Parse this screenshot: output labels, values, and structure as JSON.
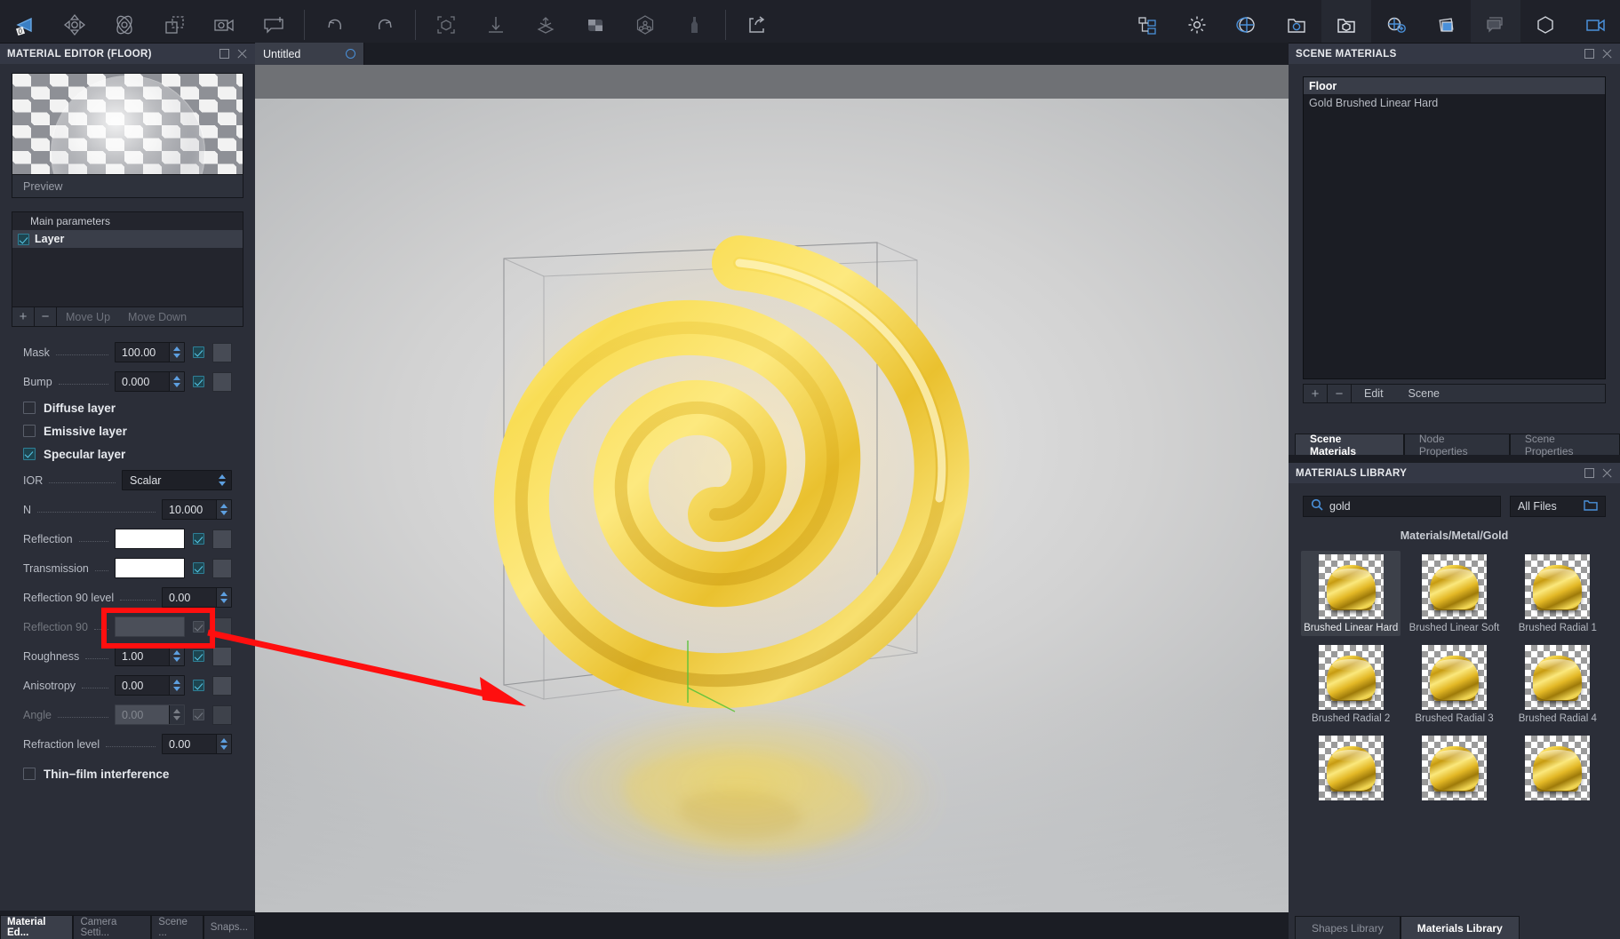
{
  "app": {
    "toolbar_left": [
      {
        "name": "select-tool",
        "icon": "cursor-arrow-icon"
      },
      {
        "name": "move-tool",
        "icon": "move-arrows-icon"
      },
      {
        "name": "rotate-tool",
        "icon": "orbit-rotate-icon"
      },
      {
        "name": "duplicate-tool",
        "icon": "copy-selection-icon"
      },
      {
        "name": "camera-settings-tool",
        "icon": "camera-gear-icon"
      },
      {
        "name": "add-annotation-tool",
        "icon": "note-plus-icon"
      },
      {
        "name": "undo",
        "icon": "undo-arrow-icon"
      },
      {
        "name": "redo",
        "icon": "redo-arrow-icon"
      },
      {
        "name": "fit-to-view",
        "icon": "cube-frame-icon"
      },
      {
        "name": "drop-to-floor",
        "icon": "down-arrow-to-line-icon"
      },
      {
        "name": "align-object",
        "icon": "axis-plane-icon"
      },
      {
        "name": "checker-pattern",
        "icon": "checker-square-icon"
      },
      {
        "name": "pivot-node",
        "icon": "hex-node-icon"
      },
      {
        "name": "measure-tool",
        "icon": "bottle-shape-icon"
      },
      {
        "name": "share-export",
        "icon": "share-arrow-icon"
      }
    ],
    "toolbar_right": [
      {
        "name": "scene-tree-panel",
        "icon": "tree-hierarchy-icon"
      },
      {
        "name": "preferences",
        "icon": "gear-icon"
      },
      {
        "name": "environment-panel",
        "icon": "globe-sphere-icon"
      },
      {
        "name": "environment-library",
        "icon": "folder-sphere-icon"
      },
      {
        "name": "shapes-library",
        "icon": "folder-cube-icon"
      },
      {
        "name": "add-environment",
        "icon": "sphere-plus-icon"
      },
      {
        "name": "images-panel",
        "icon": "photos-stack-icon"
      },
      {
        "name": "annotations-panel",
        "icon": "chat-bubbles-icon"
      },
      {
        "name": "geometry-panel",
        "icon": "cube-outline-icon"
      },
      {
        "name": "render-video-panel",
        "icon": "video-camera-icon"
      }
    ]
  },
  "material_editor": {
    "title": "MATERIAL EDITOR (FLOOR)",
    "preview_label": "Preview",
    "layers": {
      "header": "Main parameters",
      "items": [
        {
          "label": "Layer",
          "enabled": true
        }
      ],
      "footer": {
        "add": "+",
        "remove": "−",
        "move_up": "Move Up",
        "move_down": "Move Down"
      }
    },
    "params": [
      {
        "label": "Mask",
        "type": "spin",
        "value": "100.00",
        "check": true,
        "checked": true,
        "texture": true,
        "disabled": false
      },
      {
        "label": "Bump",
        "type": "spin",
        "value": "0.000",
        "check": true,
        "checked": true,
        "texture": true,
        "disabled": false
      }
    ],
    "layer_toggles": [
      {
        "label": "Diffuse layer",
        "checked": false
      },
      {
        "label": "Emissive layer",
        "checked": false
      },
      {
        "label": "Specular layer",
        "checked": true
      }
    ],
    "specular_params": [
      {
        "label": "IOR",
        "type": "combo",
        "value": "Scalar",
        "disabled": false
      },
      {
        "label": "N",
        "type": "spin",
        "value": "10.000",
        "check": false,
        "texture": false,
        "disabled": false
      },
      {
        "label": "Reflection",
        "type": "color",
        "value": "#ffffff",
        "check": true,
        "checked": true,
        "texture": true,
        "disabled": false
      },
      {
        "label": "Transmission",
        "type": "color",
        "value": "#ffffff",
        "check": true,
        "checked": true,
        "texture": true,
        "disabled": false
      },
      {
        "label": "Reflection 90 level",
        "type": "spin",
        "value": "0.00",
        "check": false,
        "texture": false,
        "disabled": false
      },
      {
        "label": "Reflection 90",
        "type": "spin",
        "value": "",
        "check": true,
        "checked": true,
        "texture": true,
        "disabled": true
      },
      {
        "label": "Roughness",
        "type": "spin",
        "value": "1.00",
        "check": true,
        "checked": true,
        "texture": true,
        "disabled": false,
        "highlighted": true
      },
      {
        "label": "Anisotropy",
        "type": "spin",
        "value": "0.00",
        "check": true,
        "checked": true,
        "texture": true,
        "disabled": false
      },
      {
        "label": "Angle",
        "type": "spin",
        "value": "0.00",
        "check": true,
        "checked": true,
        "texture": true,
        "disabled": true
      },
      {
        "label": "Refraction level",
        "type": "spin",
        "value": "0.00",
        "check": false,
        "texture": false,
        "disabled": false
      }
    ],
    "thin_film": {
      "label": "Thin−film interference",
      "checked": false
    },
    "bottom_tabs": [
      {
        "label": "Material Ed...",
        "selected": true
      },
      {
        "label": "Camera Setti...",
        "selected": false
      },
      {
        "label": "Scene ...",
        "selected": false
      },
      {
        "label": "Snaps...",
        "selected": false
      }
    ]
  },
  "viewport": {
    "tab_label": "Untitled",
    "tab_icon": "progress-circle-icon"
  },
  "scene_materials": {
    "title": "SCENE MATERIALS",
    "items": [
      {
        "label": "Floor",
        "selected": true
      },
      {
        "label": "Gold Brushed Linear Hard",
        "selected": false
      }
    ],
    "footer": {
      "add": "+",
      "remove": "−",
      "edit": "Edit",
      "scene": "Scene"
    },
    "tabs": [
      {
        "label": "Scene Materials",
        "selected": true
      },
      {
        "label": "Node Properties",
        "selected": false
      },
      {
        "label": "Scene Properties",
        "selected": false
      }
    ]
  },
  "materials_library": {
    "title": "MATERIALS LIBRARY",
    "search": {
      "value": "gold",
      "placeholder": "Search",
      "icon": "search-icon"
    },
    "filter": {
      "label": "All Files",
      "icon": "folder-icon"
    },
    "path": "Materials/Metal/Gold",
    "items": [
      {
        "label": "Brushed Linear Hard",
        "selected": true
      },
      {
        "label": "Brushed Linear Soft",
        "selected": false
      },
      {
        "label": "Brushed Radial 1",
        "selected": false
      },
      {
        "label": "Brushed Radial 2",
        "selected": false
      },
      {
        "label": "Brushed Radial 3",
        "selected": false
      },
      {
        "label": "Brushed Radial 4",
        "selected": false
      },
      {
        "label": "",
        "selected": false
      },
      {
        "label": "",
        "selected": false
      },
      {
        "label": "",
        "selected": false
      }
    ],
    "tabs": [
      {
        "label": "Shapes Library",
        "selected": false
      },
      {
        "label": "Materials Library",
        "selected": true
      }
    ]
  },
  "annotation": {
    "highlight_color": "#ff0f0f",
    "target": "Roughness"
  }
}
